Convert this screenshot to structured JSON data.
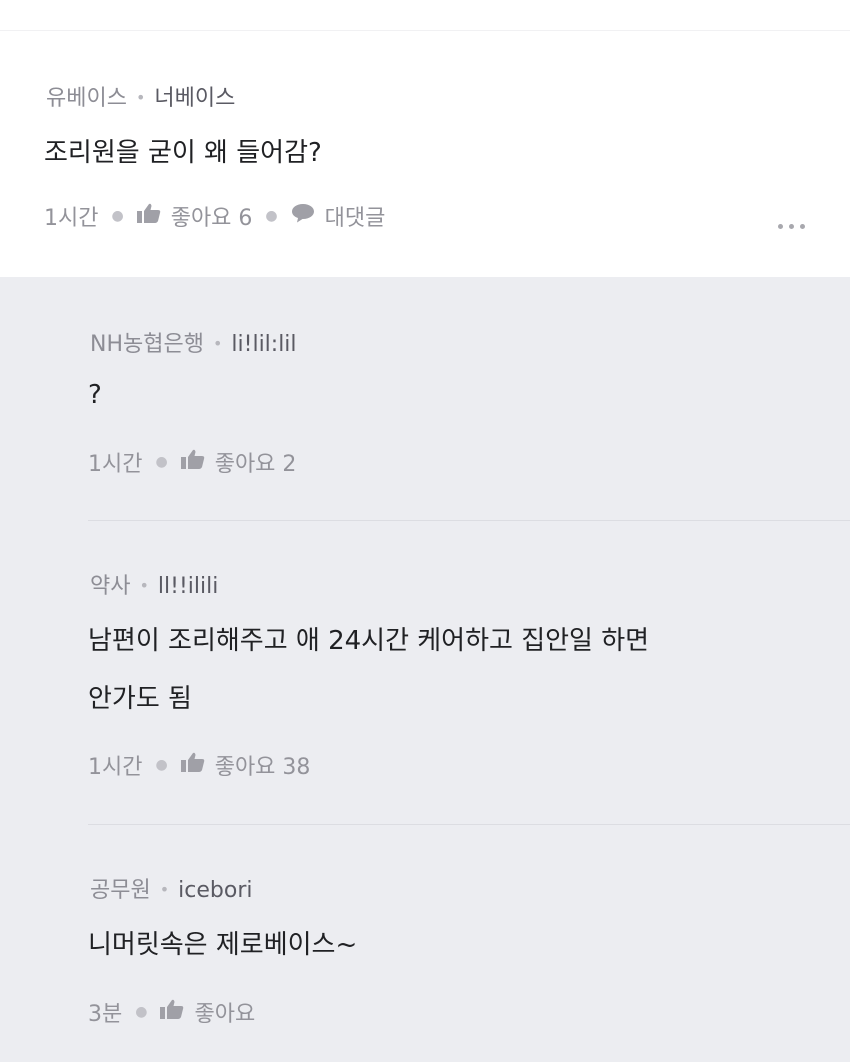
{
  "main_comment": {
    "badge": "유베이스",
    "author": "너베이스",
    "text": "조리원을 굳이 왜 들어감?",
    "time": "1시간",
    "like_label": "좋아요 6",
    "reply_label": "대댓글"
  },
  "replies": [
    {
      "badge": "NH농협은행",
      "author": "li!lil:lil",
      "lines": [
        "?"
      ],
      "time": "1시간",
      "like_label": "좋아요 2"
    },
    {
      "badge": "약사",
      "author": "ll!!ilili",
      "lines": [
        "남편이 조리해주고 애 24시간 케어하고 집안일 하면",
        "안가도 됨"
      ],
      "time": "1시간",
      "like_label": "좋아요 38"
    },
    {
      "badge": "공무원",
      "author": "icebori",
      "lines": [
        "니머릿속은 제로베이스~"
      ],
      "time": "3분",
      "like_label": "좋아요"
    }
  ],
  "icons": {
    "like": "thumbs-up-icon",
    "reply": "speech-bubble-icon",
    "more": "more-dots-icon"
  },
  "colors": {
    "page_bg": "#ecedf1",
    "card_bg": "#ffffff",
    "meta_text": "#8d8d95",
    "body_text": "#202124"
  }
}
